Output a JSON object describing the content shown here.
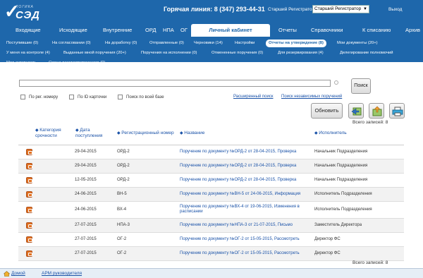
{
  "header": {
    "logo_sub": "ЛОГИКА",
    "logo_main": "СЭД",
    "hotline": "Горячая линия: 8 (347) 293-44-31",
    "registrar_label": "Старший Регистратор",
    "registrar_value": "Старший Регистратор",
    "exit": "Выход"
  },
  "mainnav": [
    {
      "label": "Входящие"
    },
    {
      "label": "Исходящие"
    },
    {
      "label": "Внутренние"
    },
    {
      "label": "ОРД"
    },
    {
      "label": "НПА"
    },
    {
      "label": "ОГ"
    },
    {
      "label": "Личный кабинет"
    },
    {
      "label": "Отчеты"
    },
    {
      "label": "Справочники"
    },
    {
      "label": "К списанию"
    },
    {
      "label": "Архив"
    }
  ],
  "subnav": [
    {
      "label": "Поступившие (0)"
    },
    {
      "label": "На согласовании (0)"
    },
    {
      "label": "На доработку (0)"
    },
    {
      "label": "Отправленные (0)"
    },
    {
      "label": "Черновики (14)"
    },
    {
      "label": "Настройки"
    },
    {
      "label": "Отчеты на утверждение (8)"
    },
    {
      "label": "Мои документы (20+)"
    },
    {
      "label": "У меня на контроле (4)"
    },
    {
      "label": "Выданные мной поручения (20+)"
    },
    {
      "label": "Поручения на исполнении (0)"
    },
    {
      "label": "Отмененные поручения (0)"
    },
    {
      "label": "Для резервирования (4)"
    },
    {
      "label": "Делегирование полномочий"
    },
    {
      "label": "Моя активность"
    },
    {
      "label": "Смена рассматривающего (0)"
    }
  ],
  "search": {
    "value": "",
    "button": "Поиск",
    "check_reg": "По рег. номеру",
    "check_id": "По ID карточки",
    "check_all": "Поиск по всей базе",
    "advanced": "Расширенный поиск",
    "independent": "Поиск независимых поручений"
  },
  "toolbar": {
    "refresh": "Обновить",
    "total": "Всего записей: 8"
  },
  "table": {
    "headers": {
      "category": "Категория срочности",
      "date": "Дата поступления",
      "regnum": "Регистрационный номер",
      "name": "Название",
      "executor": "Исполнитель"
    },
    "rows": [
      {
        "date": "29-04-2015",
        "reg": "ОРД-2",
        "name": "Поручение по документу №ОРД-2 от 28-04-2015, Проверка",
        "exec": "Начальник Подразделения"
      },
      {
        "date": "29-04-2015",
        "reg": "ОРД-2",
        "name": "Поручение по документу №ОРД-2 от 28-04-2015, Проверка",
        "exec": "Начальник Подразделения"
      },
      {
        "date": "12-05-2015",
        "reg": "ОРД-2",
        "name": "Поручение по документу №ОРД-2 от 28-04-2015, Проверка",
        "exec": "Начальник Подразделения"
      },
      {
        "date": "24-06-2015",
        "reg": "ВН-5",
        "name": "Поручение по документу №ВН-5 от 24-06-2015, Информация",
        "exec": "Исполнитель Подразделения"
      },
      {
        "date": "24-06-2015",
        "reg": "ВХ-4",
        "name": "Поручение по документу №ВХ-4 от 19-06-2015, Изменения в расписании",
        "exec": "Исполнитель Подразделения"
      },
      {
        "date": "27-07-2015",
        "reg": "НПА-3",
        "name": "Поручение по документу №НПА-3 от 21-07-2015, Письмо",
        "exec": "Заместитель Директора"
      },
      {
        "date": "27-07-2015",
        "reg": "ОГ-2",
        "name": "Поручение по документу №ОГ-2 от 15-05-2015, Рассмотреть",
        "exec": "Директор ФС"
      },
      {
        "date": "27-07-2015",
        "reg": "ОГ-2",
        "name": "Поручение по документу №ОГ-2 от 15-05-2015, Рассмотреть",
        "exec": "Директор ФС"
      }
    ]
  },
  "footer": {
    "home": "Домой",
    "arm": "АРМ руководителя"
  },
  "colors": {
    "header_bg": "#1e67ab",
    "link": "#1a52a8",
    "row_icon": "#e07020"
  }
}
